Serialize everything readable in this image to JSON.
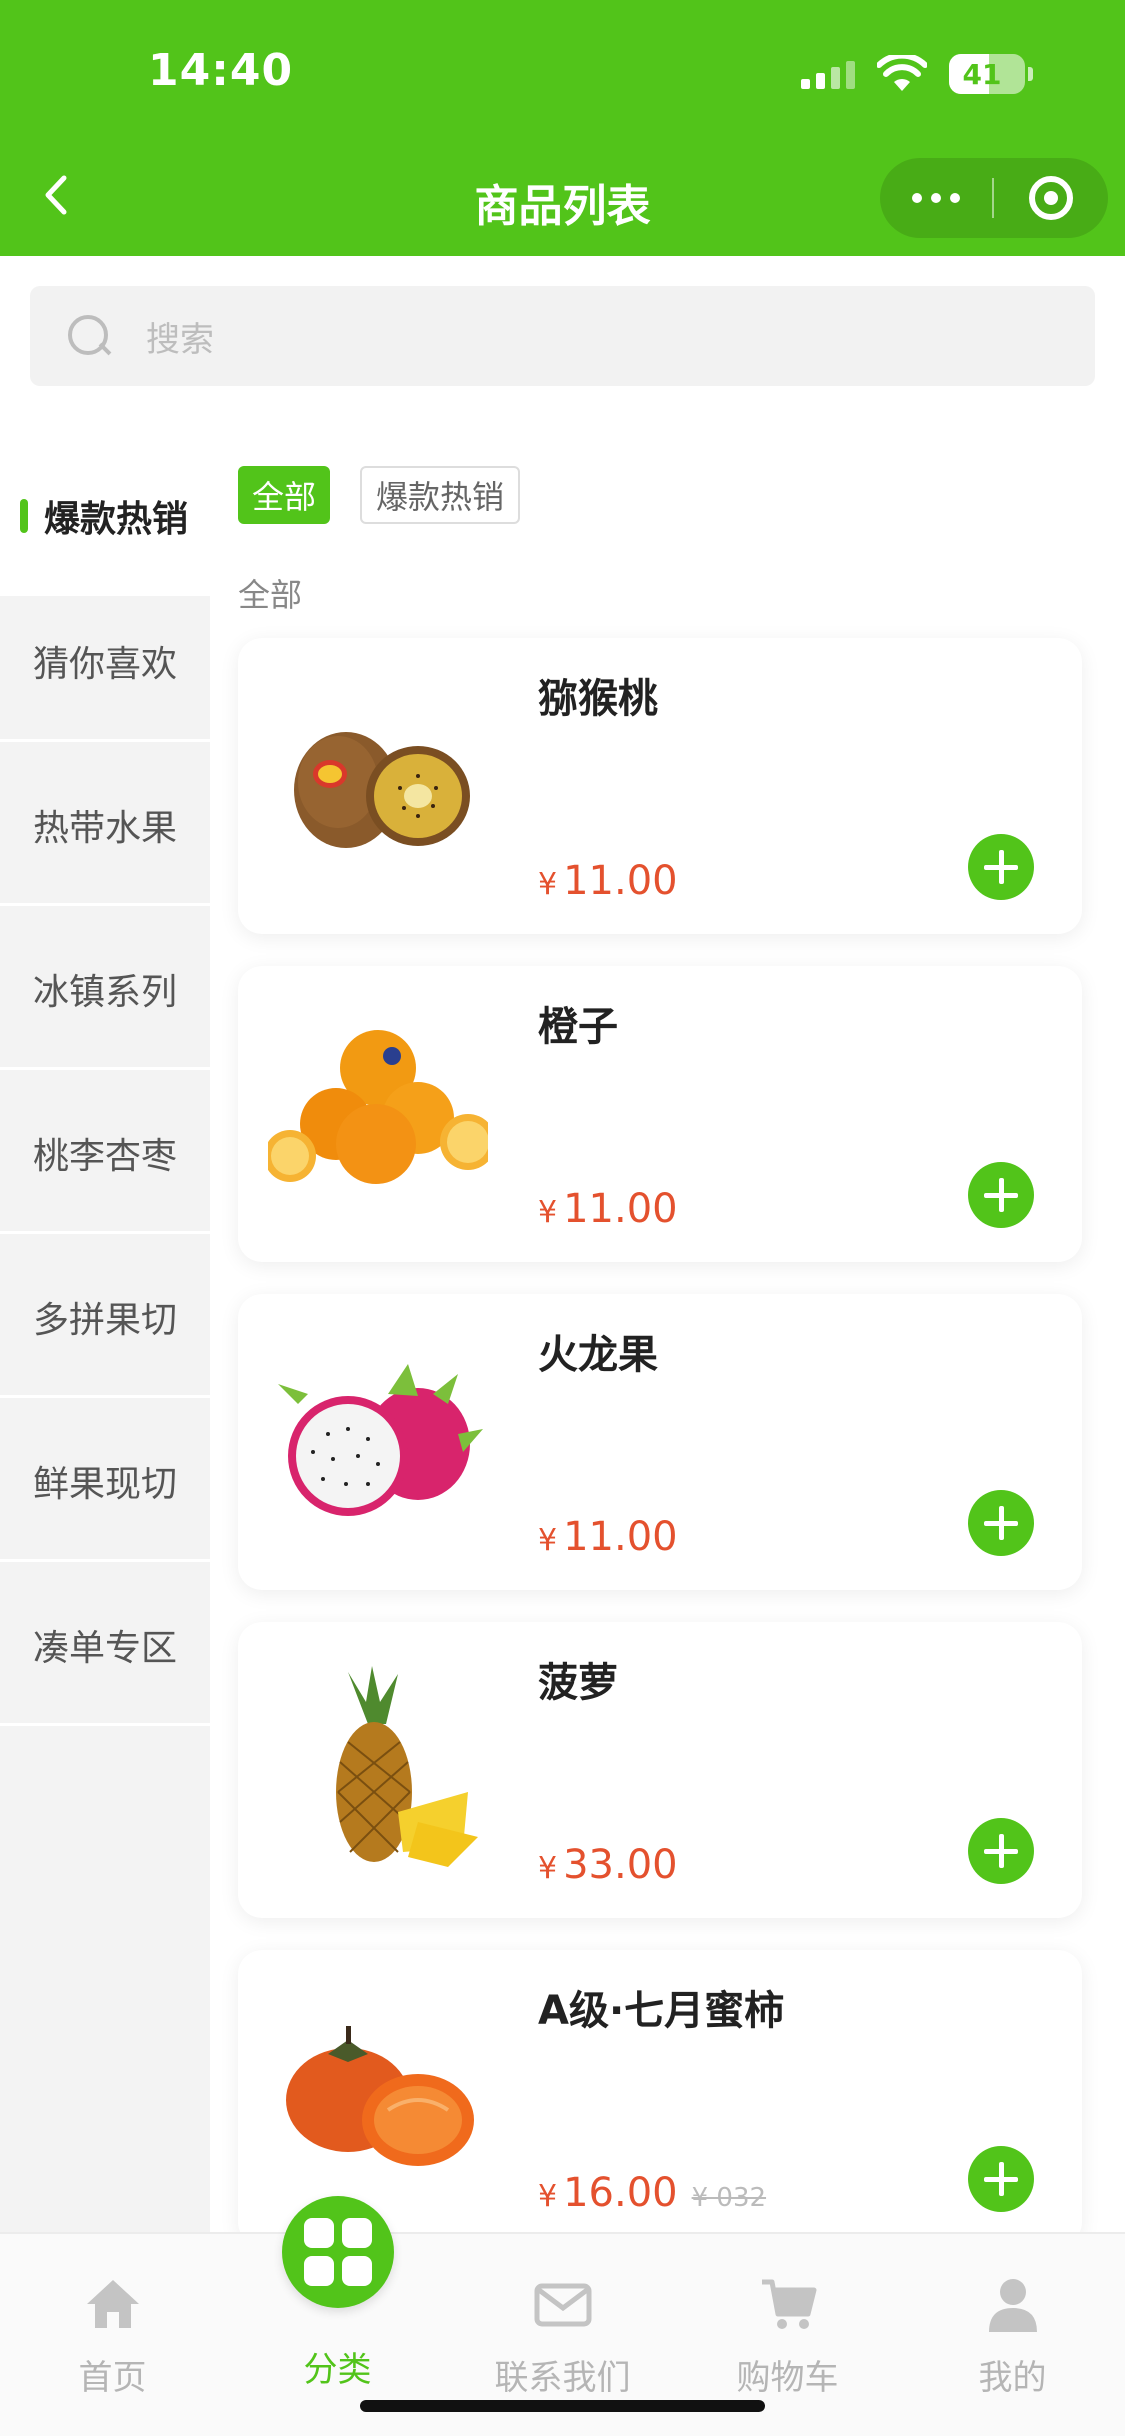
{
  "status_bar": {
    "time": "14:40",
    "battery": "41"
  },
  "header": {
    "title": "商品列表"
  },
  "search": {
    "placeholder": "搜索"
  },
  "sidebar": {
    "items": [
      {
        "label": "爆款热销",
        "active": true
      },
      {
        "label": "猜你喜欢"
      },
      {
        "label": "热带水果"
      },
      {
        "label": "冰镇系列"
      },
      {
        "label": "桃李杏枣"
      },
      {
        "label": "多拼果切"
      },
      {
        "label": "鲜果现切"
      },
      {
        "label": "凑单专区"
      }
    ]
  },
  "filters": {
    "all": "全部",
    "hot": "爆款热销"
  },
  "section": {
    "label": "全部"
  },
  "currency": "¥",
  "products": [
    {
      "name": "猕猴桃",
      "price": "11.00",
      "icon": "kiwi-image"
    },
    {
      "name": "橙子",
      "price": "11.00",
      "icon": "orange-image"
    },
    {
      "name": "火龙果",
      "price": "11.00",
      "icon": "dragon-fruit-image"
    },
    {
      "name": "菠萝",
      "price": "33.00",
      "icon": "pineapple-image"
    },
    {
      "name": "A级·七月蜜柿",
      "price": "16.00",
      "original_price": "¥ 032",
      "icon": "persimmon-image"
    }
  ],
  "tabbar": {
    "items": [
      {
        "label": "首页",
        "icon": "home-icon"
      },
      {
        "label": "分类",
        "icon": "grid-icon",
        "active": true
      },
      {
        "label": "联系我们",
        "icon": "mail-icon"
      },
      {
        "label": "购物车",
        "icon": "cart-icon"
      },
      {
        "label": "我的",
        "icon": "user-icon"
      }
    ]
  },
  "colors": {
    "brand": "#52c41a",
    "price": "#e4512e"
  }
}
